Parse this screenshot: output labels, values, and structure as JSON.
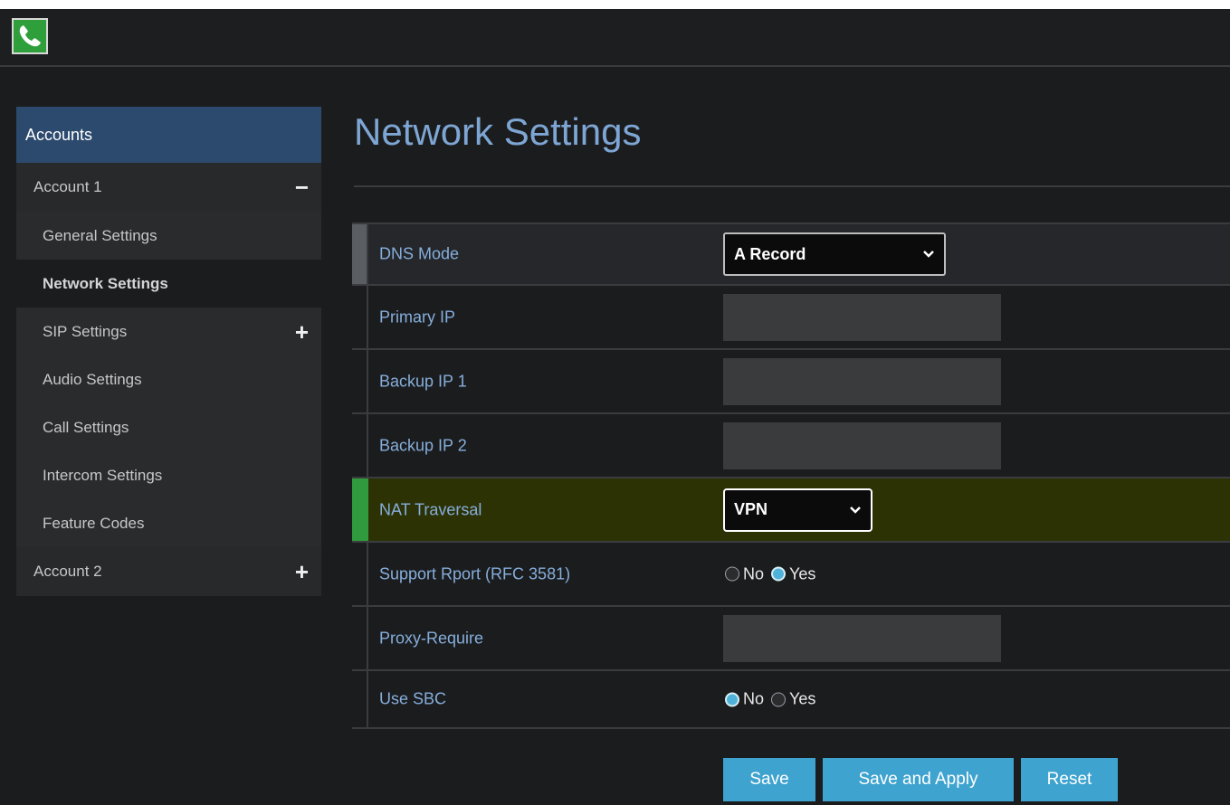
{
  "colors": {
    "sidebar_header": "#2c4a6e",
    "title": "#7ea6d4",
    "label": "#86aedb",
    "nat_row_bg": "#2d3205",
    "nat_marker": "#2f9a3e",
    "button": "#3fa3cf",
    "logo": "#2e9f3a"
  },
  "logo": {
    "icon": "phone-icon"
  },
  "sidebar": {
    "header": "Accounts",
    "account1": {
      "label": "Account 1",
      "toggle": "−"
    },
    "account1_items": [
      {
        "label": "General Settings"
      },
      {
        "label": "Network Settings"
      },
      {
        "label": "SIP Settings",
        "toggle": "+"
      },
      {
        "label": "Audio Settings"
      },
      {
        "label": "Call Settings"
      },
      {
        "label": "Intercom Settings"
      },
      {
        "label": "Feature Codes"
      }
    ],
    "account2": {
      "label": "Account 2",
      "toggle": "+"
    }
  },
  "main": {
    "title": "Network Settings",
    "fields": {
      "dns_mode": {
        "label": "DNS Mode",
        "value": "A Record"
      },
      "primary_ip": {
        "label": "Primary IP",
        "value": ""
      },
      "backup_ip1": {
        "label": "Backup IP 1",
        "value": ""
      },
      "backup_ip2": {
        "label": "Backup IP 2",
        "value": ""
      },
      "nat_traversal": {
        "label": "NAT Traversal",
        "value": "VPN"
      },
      "support_rport": {
        "label": "Support Rport (RFC 3581)",
        "no": "No",
        "yes": "Yes",
        "selected": "Yes"
      },
      "proxy_require": {
        "label": "Proxy-Require",
        "value": ""
      },
      "use_sbc": {
        "label": "Use SBC",
        "no": "No",
        "yes": "Yes",
        "selected": "No"
      }
    },
    "buttons": {
      "save": "Save",
      "save_apply": "Save and Apply",
      "reset": "Reset"
    }
  }
}
